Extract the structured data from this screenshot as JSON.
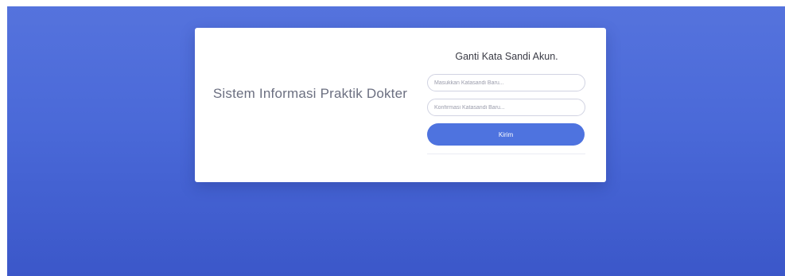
{
  "page": {
    "brand_title": "Sistem Informasi Praktik Dokter",
    "form": {
      "title": "Ganti Kata Sandi Akun.",
      "new_password_placeholder": "Masukkan Katasandi Baru...",
      "confirm_password_placeholder": "Konfirmasi Katasandi Baru...",
      "submit_label": "Kirim"
    }
  },
  "colors": {
    "background_gradient_top": "#5573dd",
    "background_gradient_bottom": "#3b57c9",
    "button_primary": "#4e73df",
    "card_background": "#ffffff"
  }
}
